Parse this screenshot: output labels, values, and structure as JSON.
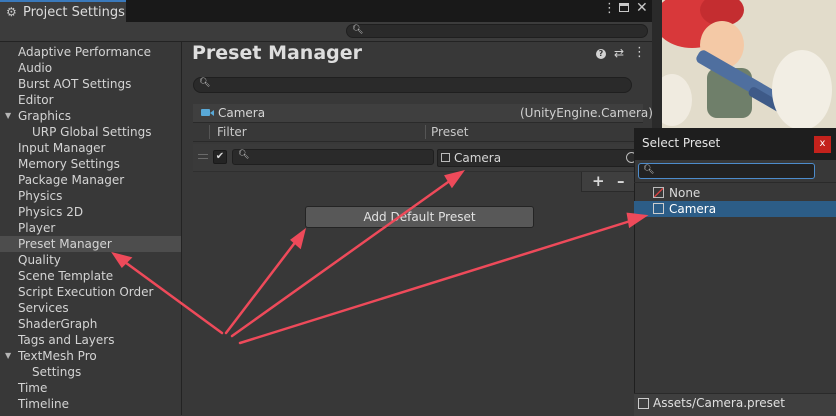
{
  "window": {
    "tab_title": "Project Settings",
    "tab_icon": "gear-icon",
    "menu_icon": "kebab-icon",
    "max_icon": "maximize-icon",
    "close_icon": "close-icon",
    "search_placeholder": ""
  },
  "sidebar": {
    "items": [
      {
        "label": "Adaptive Performance",
        "indent": 0
      },
      {
        "label": "Audio",
        "indent": 0
      },
      {
        "label": "Burst AOT Settings",
        "indent": 0
      },
      {
        "label": "Editor",
        "indent": 0
      },
      {
        "label": "Graphics",
        "indent": 0,
        "expanded": true
      },
      {
        "label": "URP Global Settings",
        "indent": 1
      },
      {
        "label": "Input Manager",
        "indent": 0
      },
      {
        "label": "Memory Settings",
        "indent": 0
      },
      {
        "label": "Package Manager",
        "indent": 0
      },
      {
        "label": "Physics",
        "indent": 0
      },
      {
        "label": "Physics 2D",
        "indent": 0
      },
      {
        "label": "Player",
        "indent": 0
      },
      {
        "label": "Preset Manager",
        "indent": 0,
        "selected": true
      },
      {
        "label": "Quality",
        "indent": 0
      },
      {
        "label": "Scene Template",
        "indent": 0
      },
      {
        "label": "Script Execution Order",
        "indent": 0
      },
      {
        "label": "Services",
        "indent": 0
      },
      {
        "label": "ShaderGraph",
        "indent": 0
      },
      {
        "label": "Tags and Layers",
        "indent": 0
      },
      {
        "label": "TextMesh Pro",
        "indent": 0,
        "expanded": true
      },
      {
        "label": "Settings",
        "indent": 1
      },
      {
        "label": "Time",
        "indent": 0
      },
      {
        "label": "Timeline",
        "indent": 0
      }
    ]
  },
  "main": {
    "title": "Preset Manager",
    "help_icon": "help-icon",
    "settings_icon": "sliders-icon",
    "menu_icon": "kebab-icon",
    "search_placeholder": "",
    "component": {
      "name": "Camera",
      "type": "(UnityEngine.Camera)",
      "icon": "camera-icon"
    },
    "columns": {
      "filter": "Filter",
      "preset": "Preset"
    },
    "row": {
      "enabled": true,
      "filter_value": "",
      "preset_value": "Camera"
    },
    "add_label": "+",
    "remove_label": "–",
    "add_default_button": "Add Default Preset"
  },
  "popup": {
    "title": "Select Preset",
    "close_label": "x",
    "search_value": "",
    "items": [
      {
        "label": "None",
        "icon": "none-icon",
        "selected": false
      },
      {
        "label": "Camera",
        "icon": "preset-icon",
        "selected": true
      }
    ],
    "footer_path": "Assets/Camera.preset"
  },
  "colors": {
    "accent": "#3a79bb",
    "selection": "#2c5d87",
    "annotation_arrow": "#ee4a5a",
    "close_red": "#c4221c"
  }
}
